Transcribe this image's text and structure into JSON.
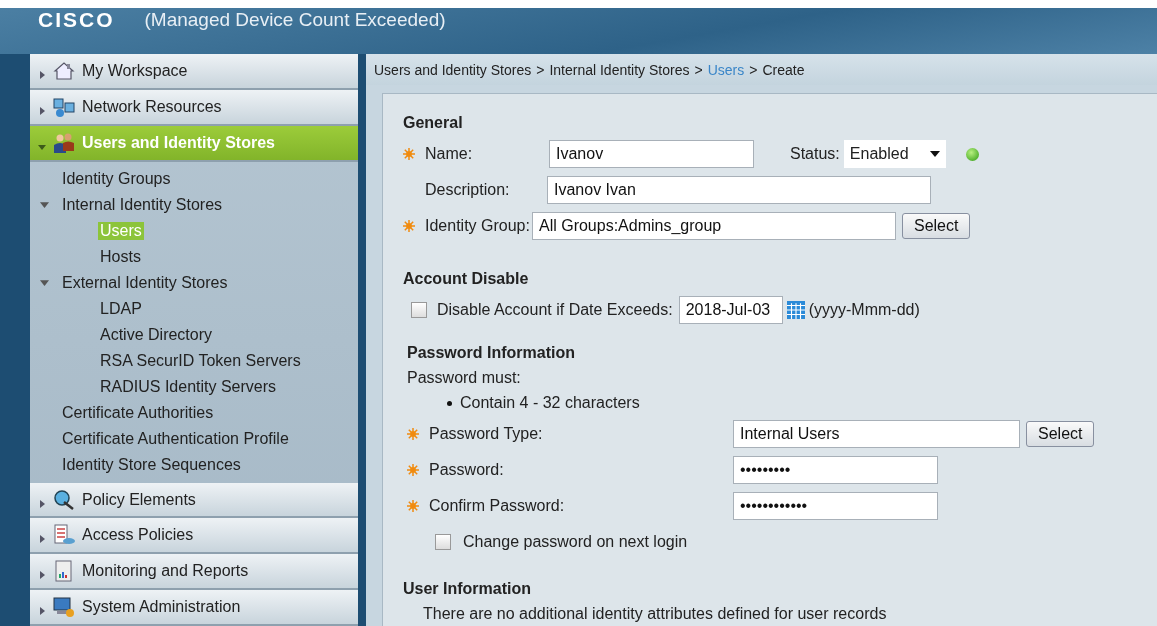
{
  "header": {
    "logo": "CISCO",
    "notice": "(Managed Device Count Exceeded)"
  },
  "sidebar": {
    "sections": [
      {
        "label": "My Workspace",
        "expanded": false,
        "selected": false
      },
      {
        "label": "Network Resources",
        "expanded": false,
        "selected": false
      },
      {
        "label": "Users and Identity Stores",
        "expanded": true,
        "selected": true,
        "children": [
          {
            "label": "Identity Groups",
            "selected": false
          },
          {
            "label": "Internal Identity Stores",
            "expanded": true,
            "selected": false,
            "children": [
              {
                "label": "Users",
                "selected": true
              },
              {
                "label": "Hosts",
                "selected": false
              }
            ]
          },
          {
            "label": "External Identity Stores",
            "expanded": true,
            "selected": false,
            "children": [
              {
                "label": "LDAP",
                "selected": false
              },
              {
                "label": "Active Directory",
                "selected": false
              },
              {
                "label": "RSA SecurID Token Servers",
                "selected": false
              },
              {
                "label": "RADIUS Identity Servers",
                "selected": false
              }
            ]
          },
          {
            "label": "Certificate Authorities",
            "selected": false
          },
          {
            "label": "Certificate Authentication Profile",
            "selected": false
          },
          {
            "label": "Identity Store Sequences",
            "selected": false
          }
        ]
      },
      {
        "label": "Policy Elements",
        "expanded": false,
        "selected": false
      },
      {
        "label": "Access Policies",
        "expanded": false,
        "selected": false
      },
      {
        "label": "Monitoring and Reports",
        "expanded": false,
        "selected": false
      },
      {
        "label": "System Administration",
        "expanded": false,
        "selected": false
      }
    ]
  },
  "breadcrumb": [
    {
      "label": "Users and Identity Stores",
      "kind": "text"
    },
    {
      "label": ">",
      "kind": "separator"
    },
    {
      "label": "Internal Identity Stores",
      "kind": "text"
    },
    {
      "label": ">",
      "kind": "separator"
    },
    {
      "label": "Users",
      "kind": "link"
    },
    {
      "label": ">",
      "kind": "separator"
    },
    {
      "label": "Create",
      "kind": "text"
    }
  ],
  "general": {
    "title": "General",
    "name": {
      "label": "Name:",
      "required": true,
      "value": "Ivanov"
    },
    "status": {
      "label": "Status:",
      "value": "Enabled",
      "active": true
    },
    "description": {
      "label": "Description:",
      "value": "Ivanov Ivan"
    },
    "identity_group": {
      "label": "Identity Group:",
      "required": true,
      "value": "All Groups:Admins_group",
      "button": "Select"
    }
  },
  "account_disable": {
    "title": "Account Disable",
    "label": "Disable Account if Date Exceeds:",
    "checked": false,
    "date": "2018-Jul-03",
    "format": "(yyyy-Mmm-dd)"
  },
  "password": {
    "title": "Password Information",
    "intro": "Password must:",
    "rules": [
      "Contain 4 - 32 characters"
    ],
    "fields": [
      {
        "label": "Password Type:",
        "required": true,
        "value": "Internal Users",
        "button": "Select",
        "wide": true
      },
      {
        "label": "Password:",
        "required": true,
        "value": "•••••••••",
        "wide": false
      },
      {
        "label": "Confirm Password:",
        "required": true,
        "value": "••••••••••••",
        "wide": false
      }
    ],
    "change_next_login": {
      "label": "Change password on next login",
      "checked": false
    }
  },
  "user_info": {
    "title": "User Information",
    "note": "There are no additional identity attributes defined for user records"
  }
}
